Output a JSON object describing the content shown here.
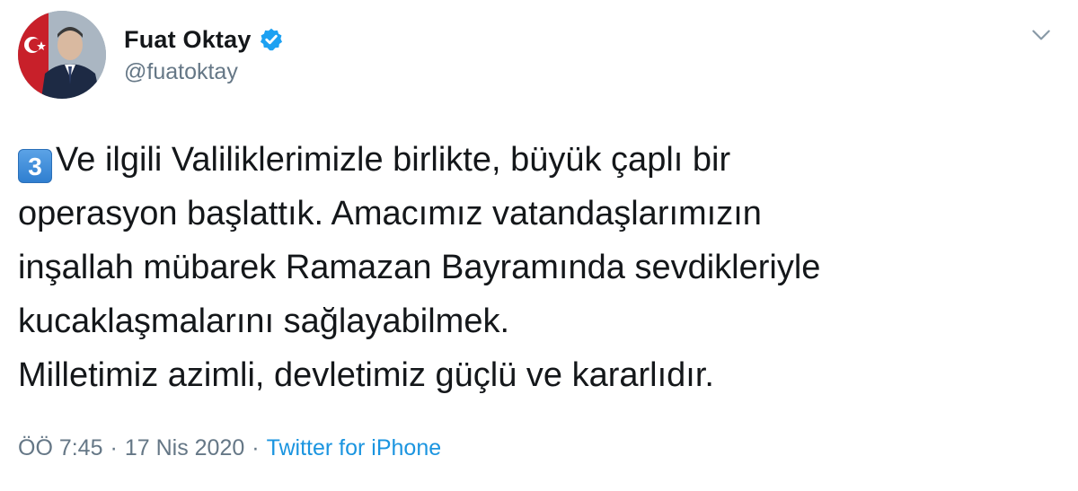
{
  "author": {
    "name": "Fuat Oktay",
    "handle": "@fuatoktay",
    "verified": true
  },
  "tweet": {
    "keycap": "3",
    "lines": [
      "Ve ilgili Valiliklerimizle birlikte, büyük çaplı bir",
      "operasyon başlattık. Amacımız vatandaşlarımızın",
      "inşallah mübarek Ramazan Bayramında sevdikleriyle",
      "kucaklaşmalarını sağlayabilmek.",
      "Milletimiz azimli, devletimiz güçlü ve kararlıdır."
    ]
  },
  "meta": {
    "time": "ÖÖ 7:45",
    "separator": "·",
    "date": "17 Nis 2020",
    "source": "Twitter for iPhone"
  },
  "colors": {
    "text": "#14171a",
    "secondary": "#657786",
    "link": "#1b95e0",
    "verified": "#1da1f2"
  }
}
